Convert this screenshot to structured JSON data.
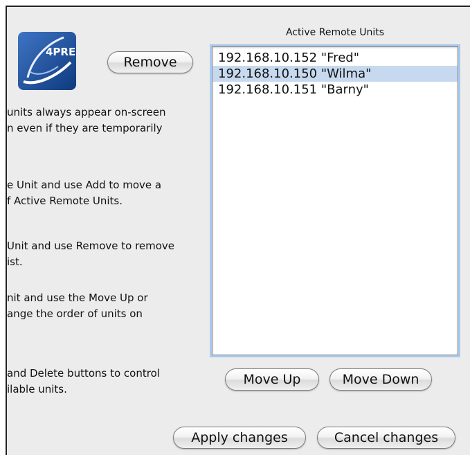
{
  "logo": {
    "text": "4PRE"
  },
  "buttons": {
    "remove": "Remove",
    "move_up": "Move Up",
    "move_down": "Move Down",
    "apply": "Apply changes",
    "cancel": "Cancel changes"
  },
  "help_lines": [
    "units always appear on-screen",
    "n even if they are temporarily",
    "e Unit and use Add to move a",
    "f Active Remote Units.",
    "Unit and use Remove to remove",
    "ist.",
    "nit and use the Move Up or",
    "ange the order of units on",
    "and Delete buttons to control",
    "ilable units."
  ],
  "active_units": {
    "title": "Active Remote Units",
    "items": [
      {
        "label": "192.168.10.152 \"Fred\"",
        "selected": false
      },
      {
        "label": "192.168.10.150 \"Wilma\"",
        "selected": true
      },
      {
        "label": "192.168.10.151 \"Barny\"",
        "selected": false
      }
    ]
  },
  "colors": {
    "window_bg": "#ececec",
    "selection": "#c7d9ef",
    "focus_ring": "#a9c9ee",
    "logo_blue": "#1f4f9a"
  }
}
